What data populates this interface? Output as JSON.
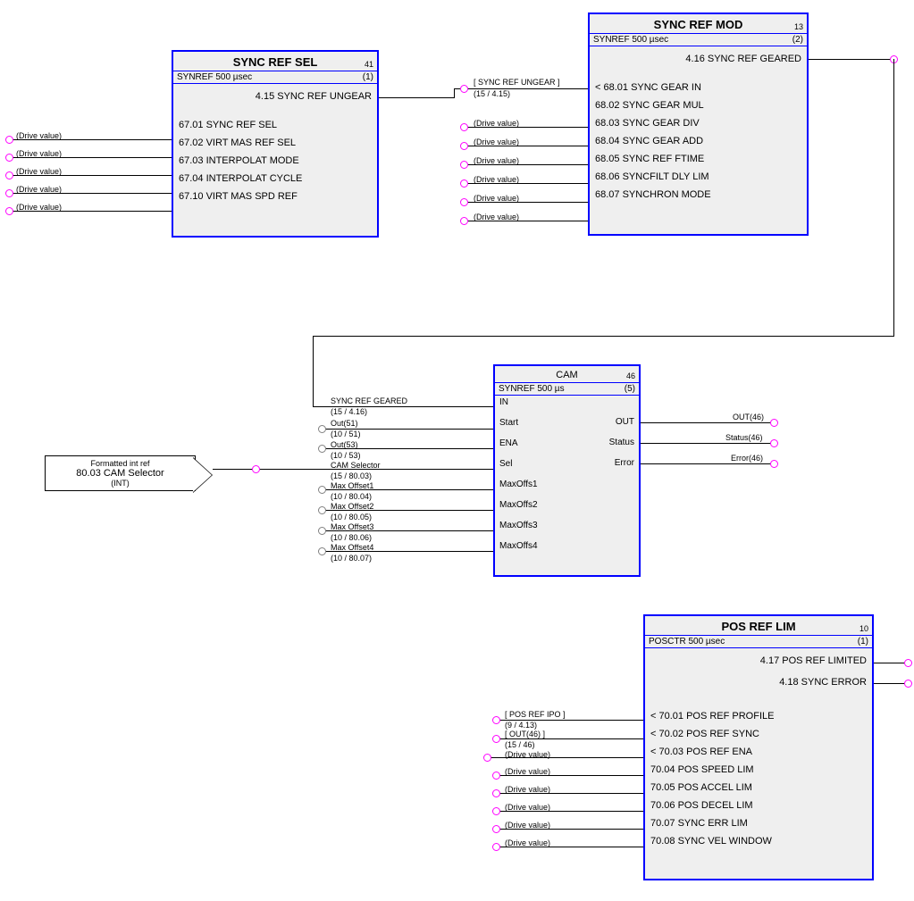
{
  "block1": {
    "title": "SYNC REF SEL",
    "index": "41",
    "timing_left": "SYNREF  500 µsec",
    "timing_right": "(1)",
    "output": "4.15 SYNC REF UNGEAR",
    "params": [
      "67.01 SYNC REF SEL",
      "67.02 VIRT MAS REF SEL",
      "67.03 INTERPOLAT MODE",
      "67.04 INTERPOLAT CYCLE",
      "67.10 VIRT MAS SPD REF"
    ],
    "driveval": "(Drive value)"
  },
  "block2": {
    "title": "SYNC REF MOD",
    "index": "13",
    "timing_left": "SYNREF  500 µsec",
    "timing_right": "(2)",
    "output": "4.16 SYNC REF GEARED",
    "params": [
      "< 68.01 SYNC GEAR IN",
      "68.02 SYNC GEAR MUL",
      "68.03 SYNC GEAR DIV",
      "68.04 SYNC GEAR ADD",
      "68.05 SYNC REF FTIME",
      "68.06 SYNCFILT DLY LIM",
      "68.07 SYNCHRON MODE"
    ],
    "in_label": "[ SYNC REF UNGEAR ]",
    "in_sub": "(15 / 4.15)",
    "driveval": "(Drive value)"
  },
  "cam": {
    "title": "CAM",
    "index": "46",
    "timing_left": "SYNREF  500 µs",
    "timing_right": "(5)",
    "in_ports": [
      "IN",
      "Start",
      "ENA",
      "Sel",
      "MaxOffs1",
      "MaxOffs2",
      "MaxOffs3",
      "MaxOffs4"
    ],
    "out_ports": [
      "OUT",
      "Status",
      "Error"
    ],
    "in_labels": [
      {
        "top": "SYNC REF GEARED",
        "sub": "(15 / 4.16)"
      },
      {
        "top": "Out(51)",
        "sub": "(10 / 51)"
      },
      {
        "top": "Out(53)",
        "sub": "(10 / 53)"
      },
      {
        "top": "CAM Selector",
        "sub": "(15 / 80.03)"
      },
      {
        "top": "Max Offset1",
        "sub": "(10 / 80.04)"
      },
      {
        "top": "Max Offset2",
        "sub": "(10 / 80.05)"
      },
      {
        "top": "Max Offset3",
        "sub": "(10 / 80.06)"
      },
      {
        "top": "Max Offset4",
        "sub": "(10 / 80.07)"
      }
    ],
    "out_labels": [
      "OUT(46)",
      "Status(46)",
      "Error(46)"
    ]
  },
  "block4": {
    "title": "POS REF LIM",
    "index": "10",
    "timing_left": "POSCTR  500 µsec",
    "timing_right": "(1)",
    "outputs": [
      "4.17 POS REF LIMITED",
      "4.18 SYNC ERROR"
    ],
    "params": [
      "< 70.01 POS REF PROFILE",
      "< 70.02 POS REF SYNC",
      "< 70.03 POS REF ENA",
      "70.04 POS SPEED LIM",
      "70.05 POS ACCEL LIM",
      "70.06 POS DECEL LIM",
      "70.07 SYNC ERR LIM",
      "70.08 SYNC VEL WINDOW"
    ],
    "in_labels": [
      {
        "top": "[ POS REF IPO ]",
        "sub": "(9 / 4.13)"
      },
      {
        "top": "[ OUT(46) ]",
        "sub": "(15 / 46)"
      }
    ],
    "driveval": "(Drive value)"
  },
  "selector": {
    "line1": "Formatted int ref",
    "line2": "80.03 CAM Selector",
    "line3": "(INT)"
  }
}
